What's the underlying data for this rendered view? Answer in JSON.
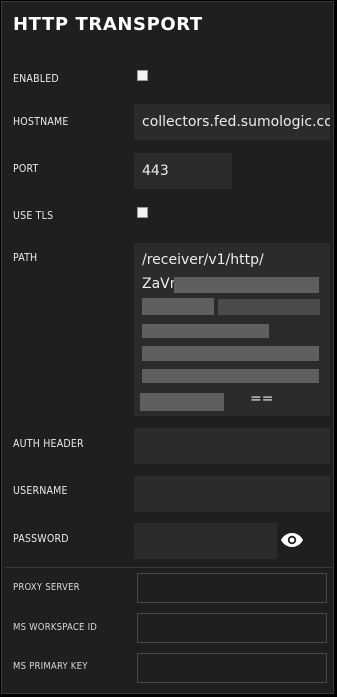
{
  "title": "HTTP TRANSPORT",
  "fields": {
    "enabled": {
      "label": "ENABLED",
      "checked": true
    },
    "hostname": {
      "label": "HOSTNAME",
      "value": "collectors.fed.sumologic.com"
    },
    "port": {
      "label": "PORT",
      "value": "443"
    },
    "use_tls": {
      "label": "USE TLS",
      "checked": true
    },
    "path": {
      "label": "PATH",
      "line1": "/receiver/v1/http/",
      "line2_prefix": "ZaVn",
      "line7_suffix": "=="
    },
    "auth_header": {
      "label": "AUTH HEADER",
      "value": ""
    },
    "username": {
      "label": "USERNAME",
      "value": ""
    },
    "password": {
      "label": "PASSWORD",
      "value": ""
    },
    "proxy_server": {
      "label": "PROXY SERVER",
      "value": ""
    },
    "ms_workspace_id": {
      "label": "MS WORKSPACE ID",
      "value": ""
    },
    "ms_primary_key": {
      "label": "MS PRIMARY KEY",
      "value": ""
    }
  },
  "icons": {
    "password_toggle": "eye-icon"
  },
  "colors": {
    "panel_bg": "#1f1f1f",
    "field_bg": "#2b2b2b",
    "text": "#ececec"
  }
}
